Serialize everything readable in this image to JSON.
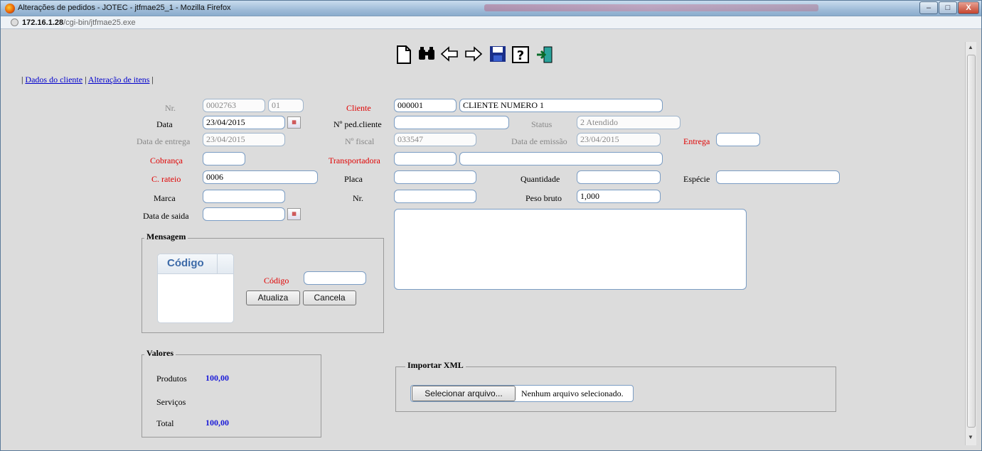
{
  "window": {
    "title": "Alterações de pedidos - JOTEC - jtfmae25_1 - Mozilla Firefox",
    "controls": [
      "–",
      "□",
      "X"
    ]
  },
  "address": {
    "host": "172.16.1.28",
    "path": "/cgi-bin/jtfmae25.exe"
  },
  "toolbar": {
    "icons": [
      "new-document-icon",
      "binoculars-icon",
      "arrow-left-icon",
      "arrow-right-icon",
      "save-icon",
      "help-icon",
      "exit-icon"
    ]
  },
  "nav": {
    "sep1": "|",
    "link1": "Dados do cliente",
    "sep2": "|",
    "link2": "Alteração de itens",
    "sep3": "|"
  },
  "form": {
    "nr_label": "Nr.",
    "nr_value": "0002763",
    "nr_suffix": "01",
    "cliente_label": "Cliente",
    "cliente_code": "000001",
    "cliente_name": "CLIENTE NUMERO 1",
    "data_label": "Data",
    "data_value": "23/04/2015",
    "ped_cliente_label": "Nº ped.cliente",
    "ped_cliente_value": "",
    "status_label": "Status",
    "status_value": "2 Atendido",
    "data_entrega_label": "Data de entrega",
    "data_entrega_value": "23/04/2015",
    "nfiscal_label": "Nº fiscal",
    "nfiscal_value": "033547",
    "data_emissao_label": "Data de emissão",
    "data_emissao_value": "23/04/2015",
    "entrega_label": "Entrega",
    "entrega_value": "",
    "cobranca_label": "Cobrança",
    "cobranca_value": "",
    "transportadora_label": "Transportadora",
    "transportadora_code": "",
    "transportadora_name": "",
    "rateio_label": "C. rateio",
    "rateio_value": "0006",
    "placa_label": "Placa",
    "placa_value": "",
    "quantidade_label": "Quantidade",
    "quantidade_value": "",
    "especie_label": "Espécie",
    "especie_value": "",
    "marca_label": "Marca",
    "marca_value": "",
    "nr2_label": "Nr.",
    "nr2_value": "",
    "peso_label": "Peso bruto",
    "peso_value": "1,000",
    "saida_label": "Data de saida",
    "saida_value": ""
  },
  "mensagem": {
    "legend": "Mensagem",
    "grid_header": "Código",
    "codigo_label": "Código",
    "codigo_value": "",
    "atualiza": "Atualiza",
    "cancela": "Cancela"
  },
  "valores": {
    "legend": "Valores",
    "produtos_label": "Produtos",
    "produtos_value": "100,00",
    "servicos_label": "Serviços",
    "total_label": "Total",
    "total_value": "100,00"
  },
  "xml": {
    "legend": "Importar XML",
    "select_button": "Selecionar arquivo...",
    "no_file": "Nenhum arquivo selecionado."
  },
  "colors": {
    "required_label": "#e00000",
    "link": "#0000cc",
    "value_blue": "#1a1ad8"
  }
}
